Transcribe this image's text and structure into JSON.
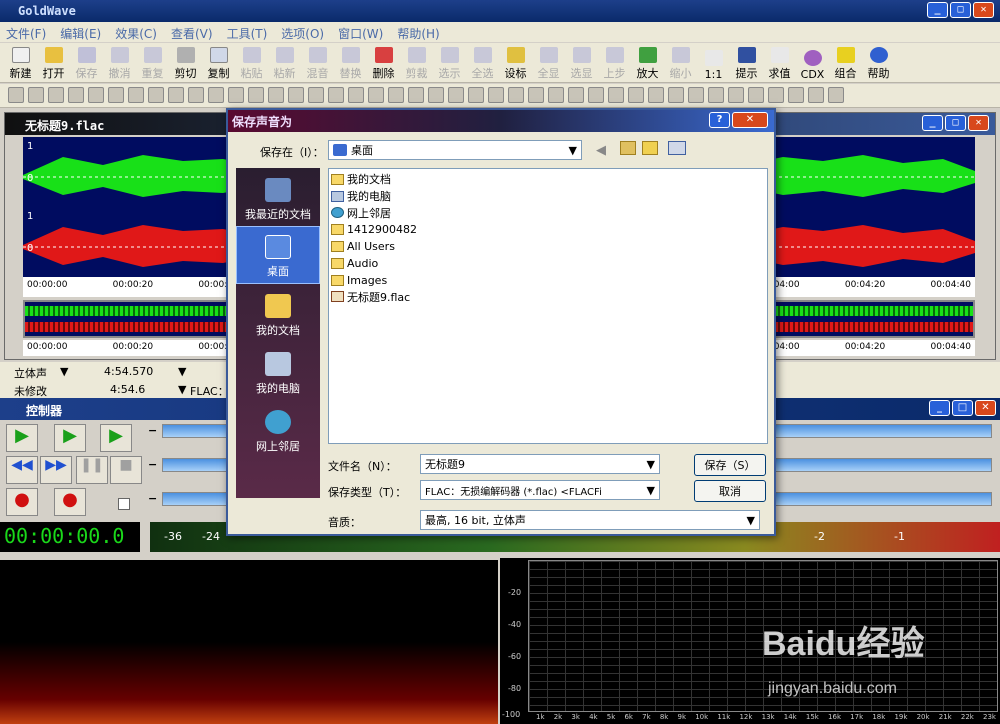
{
  "app": {
    "title": "GoldWave"
  },
  "menu": [
    "文件(F)",
    "编辑(E)",
    "效果(C)",
    "查看(V)",
    "工具(T)",
    "选项(O)",
    "窗口(W)",
    "帮助(H)"
  ],
  "toolbar": [
    "新建",
    "打开",
    "保存",
    "撤消",
    "重复",
    "剪切",
    "复制",
    "粘贴",
    "粘新",
    "混音",
    "替换",
    "删除",
    "剪裁",
    "选示",
    "全选",
    "设标",
    "全显",
    "选显",
    "上步",
    "放大",
    "缩小",
    "1:1",
    "提示",
    "求值",
    "CDX",
    "组合",
    "帮助"
  ],
  "wave_window": {
    "title": "无标题9.flac",
    "ruler_left": [
      "00:00:00",
      "00:00:20",
      "00:00:40"
    ],
    "ruler_right": [
      "00:04:00",
      "00:04:20",
      "00:04:40"
    ],
    "ruler2_left": [
      "00:00:00",
      "00:00:20",
      "00:00:40"
    ],
    "ruler2_right": [
      "00:04:00",
      "00:04:20",
      "00:04:40"
    ],
    "ch_label_1": "1",
    "ch_label_0": "0"
  },
  "status": {
    "row1_mode": "立体声",
    "row1_time": "4:54.570",
    "row2_mode": "未修改",
    "row2_time": "4:54.6",
    "row2_fmt": "FLAC："
  },
  "controller": {
    "title": "控制器",
    "clock": "00:00:00.0",
    "meter_ticks": [
      "-36",
      "-24",
      "-2",
      "-1"
    ]
  },
  "spectrum": {
    "y_ticks": [
      "-20",
      "-40",
      "-60",
      "-80",
      "-100"
    ],
    "x_ticks": [
      "1k",
      "2k",
      "3k",
      "4k",
      "5k",
      "6k",
      "7k",
      "8k",
      "9k",
      "10k",
      "11k",
      "12k",
      "13k",
      "14k",
      "15k",
      "16k",
      "17k",
      "18k",
      "19k",
      "20k",
      "21k",
      "22k",
      "23k"
    ]
  },
  "dialog": {
    "title": "保存声音为",
    "save_in_label": "保存在（I）：",
    "save_in_value": "桌面",
    "places": [
      "我最近的文档",
      "桌面",
      "我的文档",
      "我的电脑",
      "网上邻居"
    ],
    "files": [
      "我的文档",
      "我的电脑",
      "网上邻居",
      "1412900482",
      "All Users",
      "Audio",
      "Images",
      "无标题9.flac"
    ],
    "filename_label": "文件名（N）：",
    "filename_value": "无标题9",
    "filetype_label": "保存类型（T）：",
    "filetype_value": "FLAC：无损编解码器 (*.flac)    <FLACFi",
    "quality_label": "音质：",
    "quality_value": "最高, 16 bit, 立体声",
    "save_button": "保存（S）",
    "cancel_button": "取消"
  },
  "watermark": {
    "brand": "Baidu经验",
    "url": "jingyan.baidu.com"
  }
}
